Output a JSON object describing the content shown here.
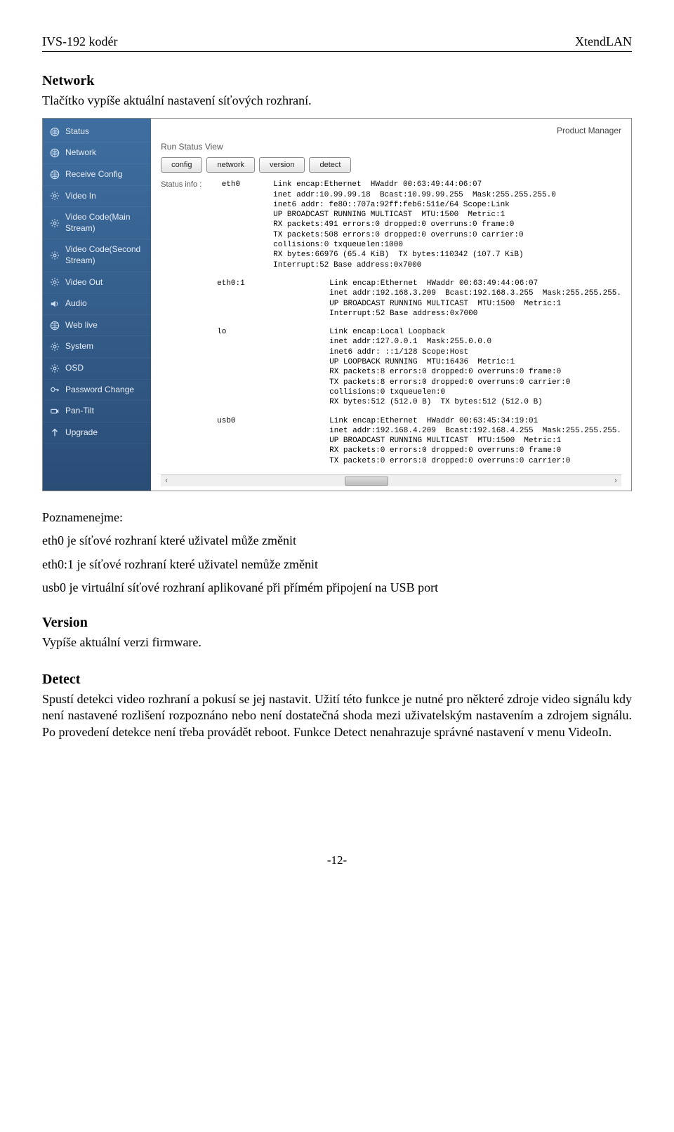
{
  "header": {
    "left": "IVS-192 kodér",
    "right": "XtendLAN"
  },
  "sections": {
    "network": {
      "title": "Network",
      "intro": "Tlačítko vypíše aktuální nastavení síťových rozhraní."
    },
    "note": {
      "lead": "Poznamenejme:",
      "eth0": "eth0  je síťové rozhraní které uživatel může změnit",
      "eth01": "eth0:1 je síťové rozhraní které uživatel nemůže změnit",
      "usb0": "usb0 je virtuální síťové rozhraní aplikované při přímém připojení na USB port"
    },
    "version": {
      "title": "Version",
      "body": "Vypíše aktuální verzi firmware."
    },
    "detect": {
      "title": "Detect",
      "body": "Spustí detekci video rozhraní a pokusí se jej nastavit. Užití této funkce je nutné pro některé zdroje video signálu kdy není nastavené rozlišení rozpoznáno nebo není dostatečná shoda mezi uživatelským nastavením a zdrojem signálu. Po provedení detekce není třeba provádět reboot. Funkce Detect nenahrazuje správné nastavení v menu VideoIn."
    }
  },
  "screenshot": {
    "product_manager": "Product Manager",
    "run_status_view": "Run Status View",
    "status_info_label": "Status info :",
    "tabs": {
      "config": "config",
      "network": "network",
      "version": "version",
      "detect": "detect"
    },
    "sidebar": [
      {
        "icon": "globe",
        "label": "Status"
      },
      {
        "icon": "globe",
        "label": "Network"
      },
      {
        "icon": "globe",
        "label": "Receive Config"
      },
      {
        "icon": "gear",
        "label": "Video In"
      },
      {
        "icon": "gear",
        "label": "Video Code(Main Stream)"
      },
      {
        "icon": "gear",
        "label": "Video Code(Second Stream)"
      },
      {
        "icon": "gear",
        "label": "Video Out"
      },
      {
        "icon": "speaker",
        "label": "Audio"
      },
      {
        "icon": "globe",
        "label": "Web live"
      },
      {
        "icon": "gear",
        "label": "System"
      },
      {
        "icon": "gear",
        "label": "OSD"
      },
      {
        "icon": "key",
        "label": "Password Change"
      },
      {
        "icon": "camera",
        "label": "Pan-Tilt"
      },
      {
        "icon": "arrow-up",
        "label": "Upgrade"
      }
    ],
    "ifaces": [
      {
        "name": "eth0",
        "lines": [
          "Link encap:Ethernet  HWaddr 00:63:49:44:06:07",
          "inet addr:10.99.99.18  Bcast:10.99.99.255  Mask:255.255.255.0",
          "inet6 addr: fe80::707a:92ff:feb6:511e/64 Scope:Link",
          "UP BROADCAST RUNNING MULTICAST  MTU:1500  Metric:1",
          "RX packets:491 errors:0 dropped:0 overruns:0 frame:0",
          "TX packets:508 errors:0 dropped:0 overruns:0 carrier:0",
          "collisions:0 txqueuelen:1000",
          "RX bytes:66976 (65.4 KiB)  TX bytes:110342 (107.7 KiB)",
          "Interrupt:52 Base address:0x7000"
        ]
      },
      {
        "name": "eth0:1",
        "lines": [
          "Link encap:Ethernet  HWaddr 00:63:49:44:06:07",
          "inet addr:192.168.3.209  Bcast:192.168.3.255  Mask:255.255.255.",
          "UP BROADCAST RUNNING MULTICAST  MTU:1500  Metric:1",
          "Interrupt:52 Base address:0x7000"
        ]
      },
      {
        "name": "lo",
        "lines": [
          "Link encap:Local Loopback",
          "inet addr:127.0.0.1  Mask:255.0.0.0",
          "inet6 addr: ::1/128 Scope:Host",
          "UP LOOPBACK RUNNING  MTU:16436  Metric:1",
          "RX packets:8 errors:0 dropped:0 overruns:0 frame:0",
          "TX packets:8 errors:0 dropped:0 overruns:0 carrier:0",
          "collisions:0 txqueuelen:0",
          "RX bytes:512 (512.0 B)  TX bytes:512 (512.0 B)"
        ]
      },
      {
        "name": "usb0",
        "lines": [
          "Link encap:Ethernet  HWaddr 00:63:45:34:19:01",
          "inet addr:192.168.4.209  Bcast:192.168.4.255  Mask:255.255.255.",
          "UP BROADCAST RUNNING MULTICAST  MTU:1500  Metric:1",
          "RX packets:0 errors:0 dropped:0 overruns:0 frame:0",
          "TX packets:0 errors:0 dropped:0 overruns:0 carrier:0"
        ]
      }
    ]
  },
  "page_number": "-12-"
}
